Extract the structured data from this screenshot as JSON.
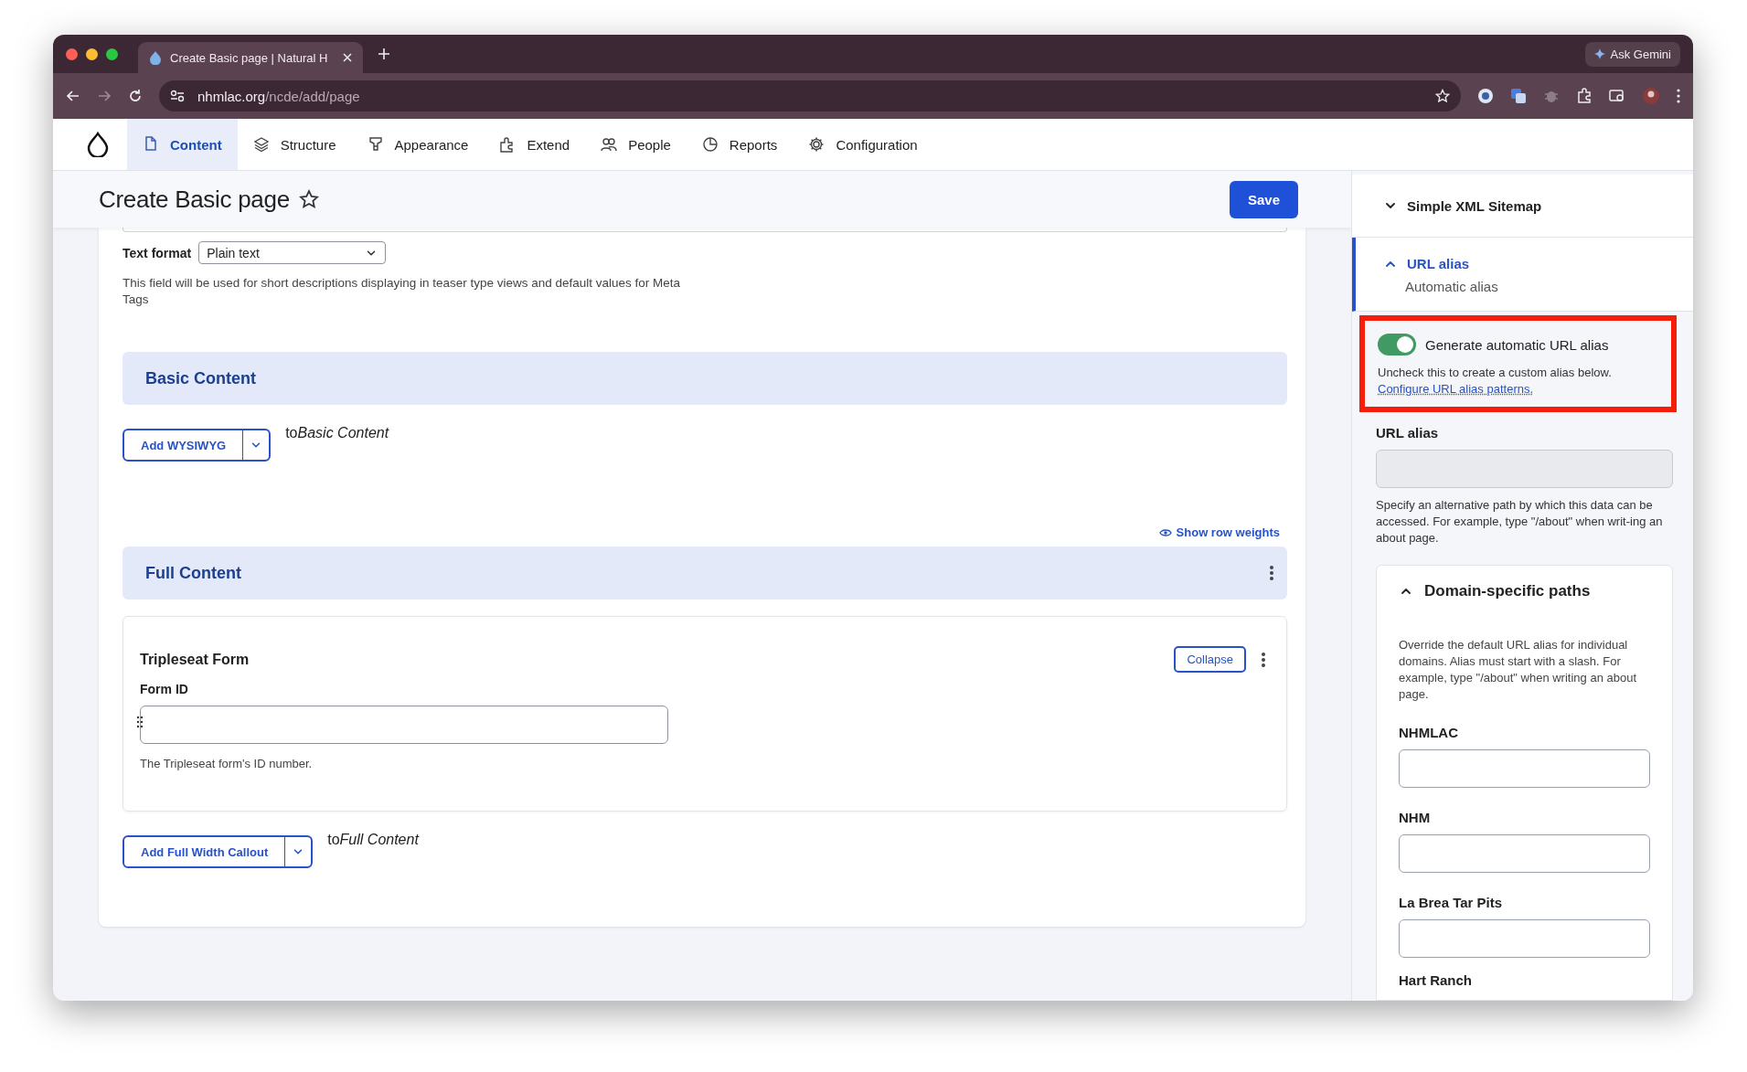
{
  "browser": {
    "tab_title": "Create Basic page | Natural H",
    "ask_gemini": "Ask Gemini",
    "url_host": "nhmlac.org",
    "url_path": "/ncde/add/page"
  },
  "toolbar": {
    "items": [
      {
        "label": "Content",
        "selected": true
      },
      {
        "label": "Structure",
        "selected": false
      },
      {
        "label": "Appearance",
        "selected": false
      },
      {
        "label": "Extend",
        "selected": false
      },
      {
        "label": "People",
        "selected": false
      },
      {
        "label": "Reports",
        "selected": false
      },
      {
        "label": "Configuration",
        "selected": false
      }
    ]
  },
  "page": {
    "title": "Create Basic page",
    "save": "Save"
  },
  "form": {
    "text_format_label": "Text format",
    "text_format_value": "Plain text",
    "description": "This field will be used for short descriptions displaying in teaser type views and default values for Meta Tags",
    "basic_content": {
      "title": "Basic Content",
      "add_button": "Add WYSIWYG",
      "to_prefix": "to",
      "target": "Basic Content"
    },
    "show_row_weights": "Show row weights",
    "full_content": {
      "title": "Full Content",
      "paragraph": {
        "title": "Tripleseat Form",
        "collapse": "Collapse",
        "field_label": "Form ID",
        "description": "The Tripleseat form's ID number."
      },
      "add_button": "Add Full Width Callout",
      "to_prefix": "to",
      "target": "Full Content"
    }
  },
  "sidebar": {
    "sitemap": {
      "title": "Simple XML Sitemap",
      "expanded": false
    },
    "url_alias_section": {
      "title": "URL alias",
      "summary": "Automatic alias",
      "expanded": true
    },
    "auto_alias": {
      "label": "Generate automatic URL alias",
      "on": true,
      "description": "Uncheck this to create a custom alias below.",
      "link": "Configure URL alias patterns."
    },
    "url_alias": {
      "label": "URL alias",
      "disabled": true,
      "description": "Specify an alternative path by which this data can be accessed. For example, type \"/about\" when writ-ing an about page."
    },
    "domain_paths": {
      "title": "Domain-specific paths",
      "expanded": true,
      "description": "Override the default URL alias for individual domains. Alias must start with a slash. For example, type \"/about\" when writing an about page.",
      "fields": [
        {
          "label": "NHMLAC"
        },
        {
          "label": "NHM"
        },
        {
          "label": "La Brea Tar Pits"
        }
      ],
      "cut_label": "Hart Ranch"
    }
  }
}
